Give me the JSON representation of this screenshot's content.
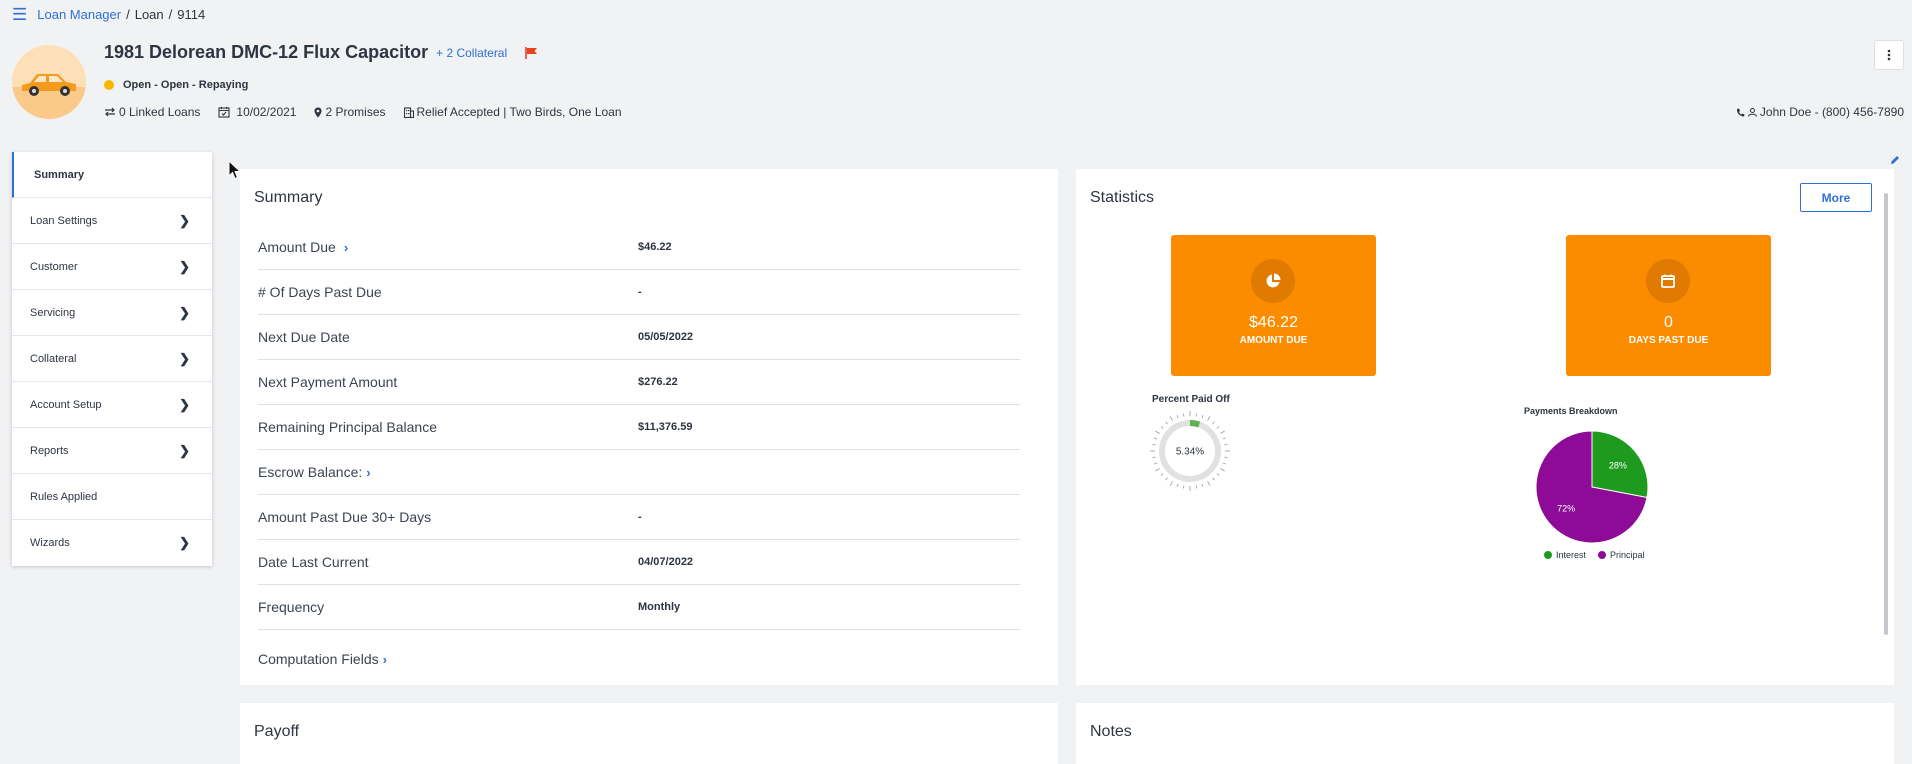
{
  "breadcrumb": {
    "app": "Loan Manager",
    "section": "Loan",
    "id": "9114",
    "sep": "/"
  },
  "loan": {
    "title": "1981 Delorean DMC-12 Flux Capacitor",
    "collateral_link": "+ 2 Collateral",
    "status": "Open - Open - Repaying",
    "linked_loans": "0 Linked Loans",
    "date": "10/02/2021",
    "promises": "2 Promises",
    "relief": "Relief Accepted | Two Birds, One Loan",
    "contact": "John Doe - (800) 456-7890",
    "status_color": "#f5b800"
  },
  "sidebar": {
    "items": [
      {
        "label": "Summary",
        "active": true,
        "has_arrow": false
      },
      {
        "label": "Loan Settings",
        "has_arrow": true
      },
      {
        "label": "Customer",
        "has_arrow": true
      },
      {
        "label": "Servicing",
        "has_arrow": true
      },
      {
        "label": "Collateral",
        "has_arrow": true
      },
      {
        "label": "Account Setup",
        "has_arrow": true
      },
      {
        "label": "Reports",
        "has_arrow": true
      },
      {
        "label": "Rules Applied",
        "has_arrow": false
      },
      {
        "label": "Wizards",
        "has_arrow": true
      }
    ]
  },
  "summary": {
    "title": "Summary",
    "rows": [
      {
        "label": "Amount Due",
        "value": "$46.22"
      },
      {
        "label": "# Of Days Past Due",
        "value": "-"
      },
      {
        "label": "Next Due Date",
        "value": "05/05/2022"
      },
      {
        "label": "Next Payment Amount",
        "value": "$276.22"
      },
      {
        "label": "Remaining Principal Balance",
        "value": "$11,376.59"
      },
      {
        "label": "Escrow Balance:",
        "value": ""
      },
      {
        "label": "Amount Past Due 30+ Days",
        "value": "-"
      },
      {
        "label": "Date Last Current",
        "value": "04/07/2022"
      },
      {
        "label": "Frequency",
        "value": "Monthly"
      }
    ],
    "computation_fields": "Computation Fields"
  },
  "statistics": {
    "title": "Statistics",
    "more_label": "More",
    "tiles": [
      {
        "value": "$46.22",
        "label": "AMOUNT DUE",
        "icon": "pie-chart-icon"
      },
      {
        "value": "0",
        "label": "DAYS PAST DUE",
        "icon": "calendar-icon"
      }
    ],
    "tile_color": "#fb8c00",
    "percent_paid_off": {
      "label": "Percent Paid Off",
      "value": "5.34%",
      "fraction": 0.0534
    }
  },
  "chart_data": {
    "type": "pie",
    "title": "Payments Breakdown",
    "categories": [
      "Interest",
      "Principal"
    ],
    "values": [
      28,
      72
    ],
    "labels": [
      "28%",
      "72%"
    ],
    "colors": [
      "#1e9b1e",
      "#8e0b98"
    ],
    "legend": "bottom"
  },
  "payoff": {
    "title": "Payoff"
  },
  "notes": {
    "title": "Notes"
  }
}
